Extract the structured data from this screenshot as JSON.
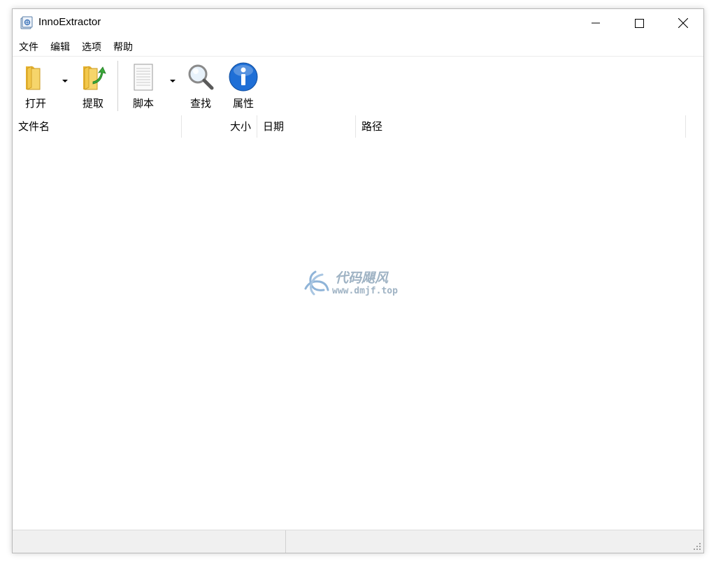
{
  "window": {
    "title": "InnoExtractor"
  },
  "menu": {
    "items": [
      "文件",
      "编辑",
      "选项",
      "帮助"
    ]
  },
  "toolbar": {
    "open_label": "打开",
    "extract_label": "提取",
    "script_label": "脚本",
    "find_label": "查找",
    "properties_label": "属性"
  },
  "list": {
    "columns": [
      "文件名",
      "大小",
      "日期",
      "路径"
    ]
  },
  "watermark": {
    "name": "代码飓风",
    "url": "www.dmjf.top"
  },
  "status": {
    "pane1": "",
    "pane2": ""
  },
  "colors": {
    "folder_yellow": "#f3c84b",
    "info_blue": "#1f6fd6",
    "extract_green": "#3aa93a"
  }
}
